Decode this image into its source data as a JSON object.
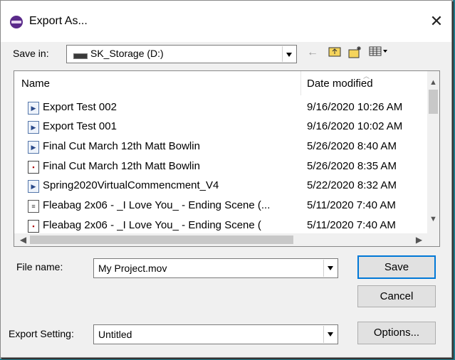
{
  "dialog": {
    "title": "Export As...",
    "close_glyph": "✕",
    "app_icon": "app-logo-icon"
  },
  "save_in": {
    "label": "Save in:",
    "value": "SK_Storage (D:)",
    "icons": {
      "drive": "drive-icon",
      "back": "←",
      "up_folder": "📁",
      "new_folder": "✱",
      "view_menu": "▦▾"
    }
  },
  "file_list": {
    "columns": {
      "name": "Name",
      "date": "Date modified"
    },
    "rows": [
      {
        "name": "Export Test 002",
        "date": "9/16/2020 10:26 AM",
        "icon": "video-file-icon"
      },
      {
        "name": "Export Test 001",
        "date": "9/16/2020 10:02 AM",
        "icon": "video-file-icon"
      },
      {
        "name": "Final Cut March 12th Matt Bowlin",
        "date": "5/26/2020 8:40 AM",
        "icon": "video-file-icon"
      },
      {
        "name": "Final Cut March 12th Matt Bowlin",
        "date": "5/26/2020 8:35 AM",
        "icon": "project-file-icon"
      },
      {
        "name": "Spring2020VirtualCommencment_V4",
        "date": "5/22/2020 8:32 AM",
        "icon": "video-file-icon"
      },
      {
        "name": "Fleabag 2x06 - _I Love You_ - Ending Scene (...",
        "date": "5/11/2020 7:40 AM",
        "icon": "text-file-icon"
      },
      {
        "name": "Fleabag 2x06 - _I Love You_ - Ending Scene (",
        "date": "5/11/2020 7:40 AM",
        "icon": "project-file-icon"
      }
    ]
  },
  "file_name": {
    "label": "File name:",
    "value": "My Project.mov"
  },
  "export_setting": {
    "label": "Export Setting:",
    "value": "Untitled"
  },
  "buttons": {
    "save": "Save",
    "cancel": "Cancel",
    "options": "Options..."
  },
  "colors": {
    "accent": "#0078d7",
    "background": "#f0f0f0"
  }
}
